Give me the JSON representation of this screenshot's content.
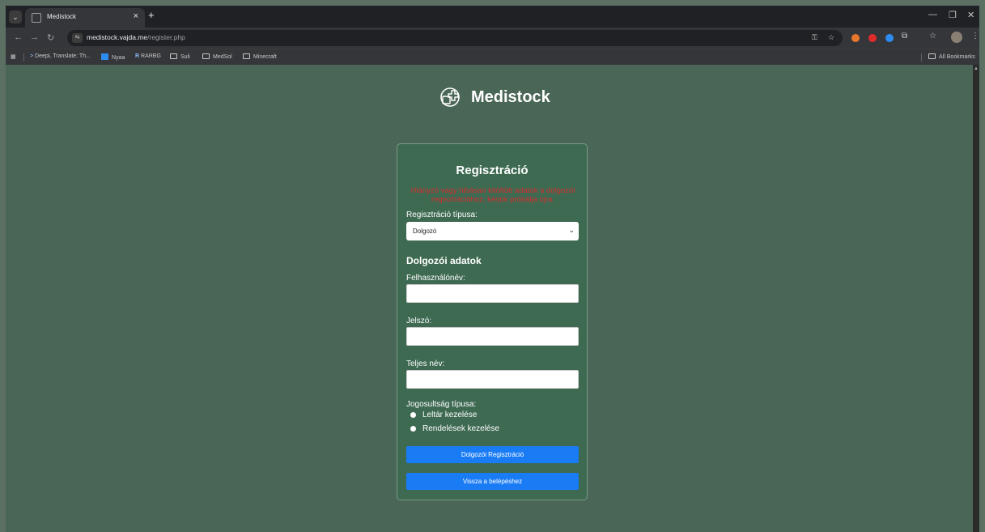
{
  "browser": {
    "tab_title": "Medistock",
    "tab_close": "×",
    "new_tab": "+",
    "url_host": "medistock.vajda.me",
    "url_path": "/register.php",
    "bookmarks": [
      "DeepL Translate: Th...",
      "Nyaa",
      "RARBG",
      "Suli",
      "MedSol",
      "Minecraft"
    ],
    "all_bookmarks": "All Bookmarks"
  },
  "page": {
    "brand": "Medistock",
    "title": "Regisztráció",
    "error": "Hiányzó vagy hibásan kitöltött adatok a dolgozói regisztrációhoz, kérjük próbálja újra.",
    "reg_type_label": "Regisztráció típusa:",
    "reg_type_value": "Dolgozó",
    "section_title": "Dolgozói adatok",
    "username_label": "Felhasználónév:",
    "password_label": "Jelszó:",
    "fullname_label": "Teljes név:",
    "permission_label": "Jogosultság típusa:",
    "permission_options": [
      "Leltár kezelése",
      "Rendelések kezelése"
    ],
    "register_button": "Dolgozói Regisztráció",
    "back_button": "Vissza a belépéshez"
  },
  "colors": {
    "page_bg": "#4a6656",
    "card_bg": "#3e6a52",
    "error": "#d32f2f",
    "button": "#1a7cf5"
  }
}
